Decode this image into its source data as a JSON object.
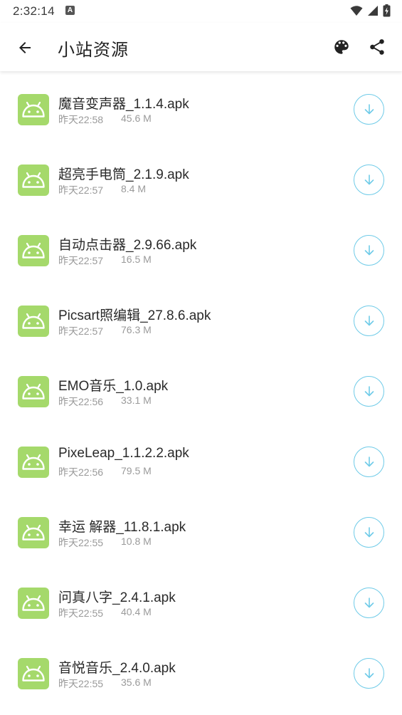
{
  "status_bar": {
    "time": "2:32:14",
    "notification_icon": "a-icon",
    "icons": [
      "wifi-icon",
      "signal-icon",
      "battery-charging-icon"
    ]
  },
  "app_bar": {
    "title": "小站资源",
    "back_icon": "arrow-back-icon",
    "palette_icon": "palette-icon",
    "share_icon": "share-icon"
  },
  "colors": {
    "app_icon_bg": "#a5d96b",
    "download_accent": "#6fcbe8",
    "meta_text": "#9a9a9a"
  },
  "files": [
    {
      "name": "魔音变声器_1.1.4.apk",
      "time": "昨天22:58",
      "size": "45.6 M"
    },
    {
      "name": "超亮手电筒_2.1.9.apk",
      "time": "昨天22:57",
      "size": "8.4 M"
    },
    {
      "name": "自动点击器_2.9.66.apk",
      "time": "昨天22:57",
      "size": "16.5 M"
    },
    {
      "name": "Picsart照编辑_27.8.6.apk",
      "time": "昨天22:57",
      "size": "76.3 M"
    },
    {
      "name": "EMO音乐_1.0.apk",
      "time": "昨天22:56",
      "size": "33.1 M"
    },
    {
      "name": "PixeLeap_1.1.2.2.apk",
      "time": "昨天22:56",
      "size": "79.5 M"
    },
    {
      "name": "幸运  解器_11.8.1.apk",
      "time": "昨天22:55",
      "size": "10.8 M"
    },
    {
      "name": "问真八字_2.4.1.apk",
      "time": "昨天22:55",
      "size": "40.4 M"
    },
    {
      "name": "音悦音乐_2.4.0.apk",
      "time": "昨天22:55",
      "size": "35.6 M"
    }
  ]
}
